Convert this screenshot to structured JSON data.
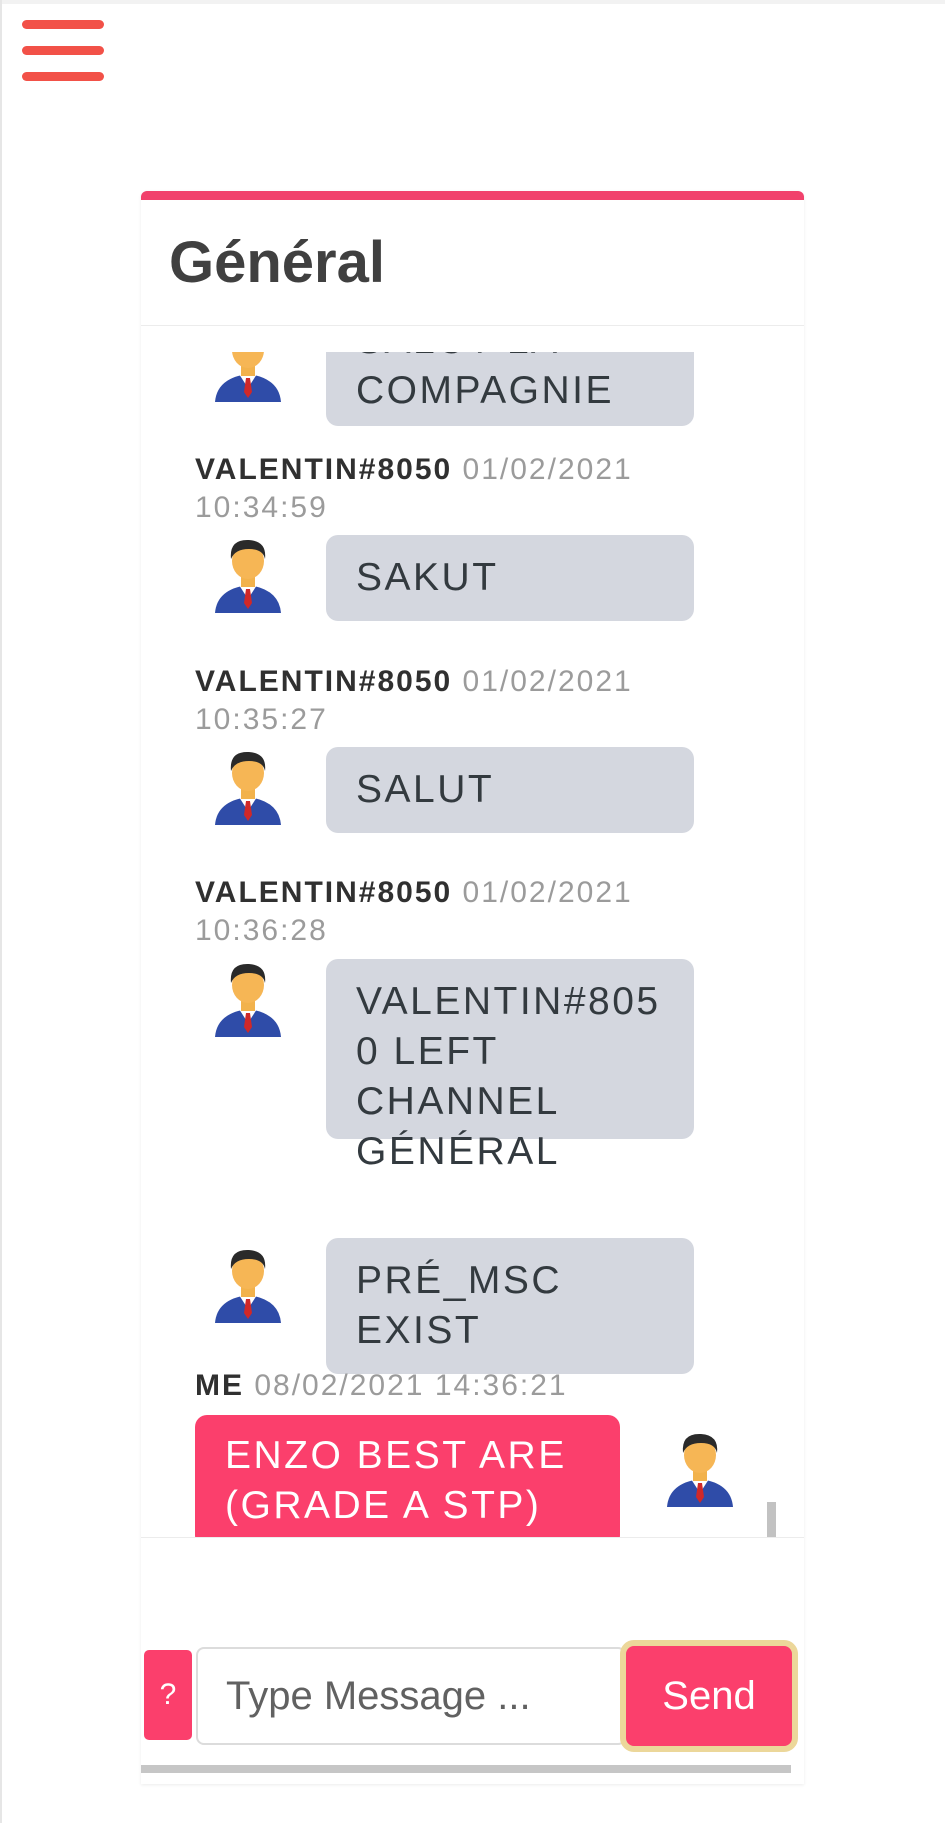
{
  "nav": {
    "menu_icon": "hamburger-menu-icon",
    "menu_color": "#f25148"
  },
  "channel": {
    "title": "Général",
    "accent": "#f1416c"
  },
  "messages": [
    {
      "user": "",
      "timestamp": "",
      "text": "Salut la compagnie",
      "own": false,
      "avatar_icon": "user-avatar-icon"
    },
    {
      "user": "VALENTIN#8050",
      "timestamp": "01/02/2021 10:34:59",
      "text": "SAKUT",
      "own": false,
      "avatar_icon": "user-avatar-icon"
    },
    {
      "user": "VALENTIN#8050",
      "timestamp": "01/02/2021 10:35:27",
      "text": "SALUT",
      "own": false,
      "avatar_icon": "user-avatar-icon"
    },
    {
      "user": "VALENTIN#8050",
      "timestamp": "01/02/2021 10:36:28",
      "text": "VALENTIN#8050 LEFT CHANNEL GÉNÉRAL",
      "own": false,
      "avatar_icon": "user-avatar-icon"
    },
    {
      "user": "",
      "timestamp": "",
      "text": "PRÉ_MSC EXIST",
      "own": false,
      "avatar_icon": "user-avatar-icon"
    },
    {
      "user": "ME",
      "timestamp": "08/02/2021 14:36:21",
      "text": "ENZO BEST ARE (GRADE A STP)",
      "own": true,
      "avatar_icon": "user-avatar-icon"
    }
  ],
  "composer": {
    "help_label": "?",
    "placeholder": "Type Message ...",
    "send_label": "Send"
  },
  "colors": {
    "bubble_other": "#d4d7df",
    "bubble_own": "#fb3f6c",
    "send_border": "#ecd79a"
  }
}
